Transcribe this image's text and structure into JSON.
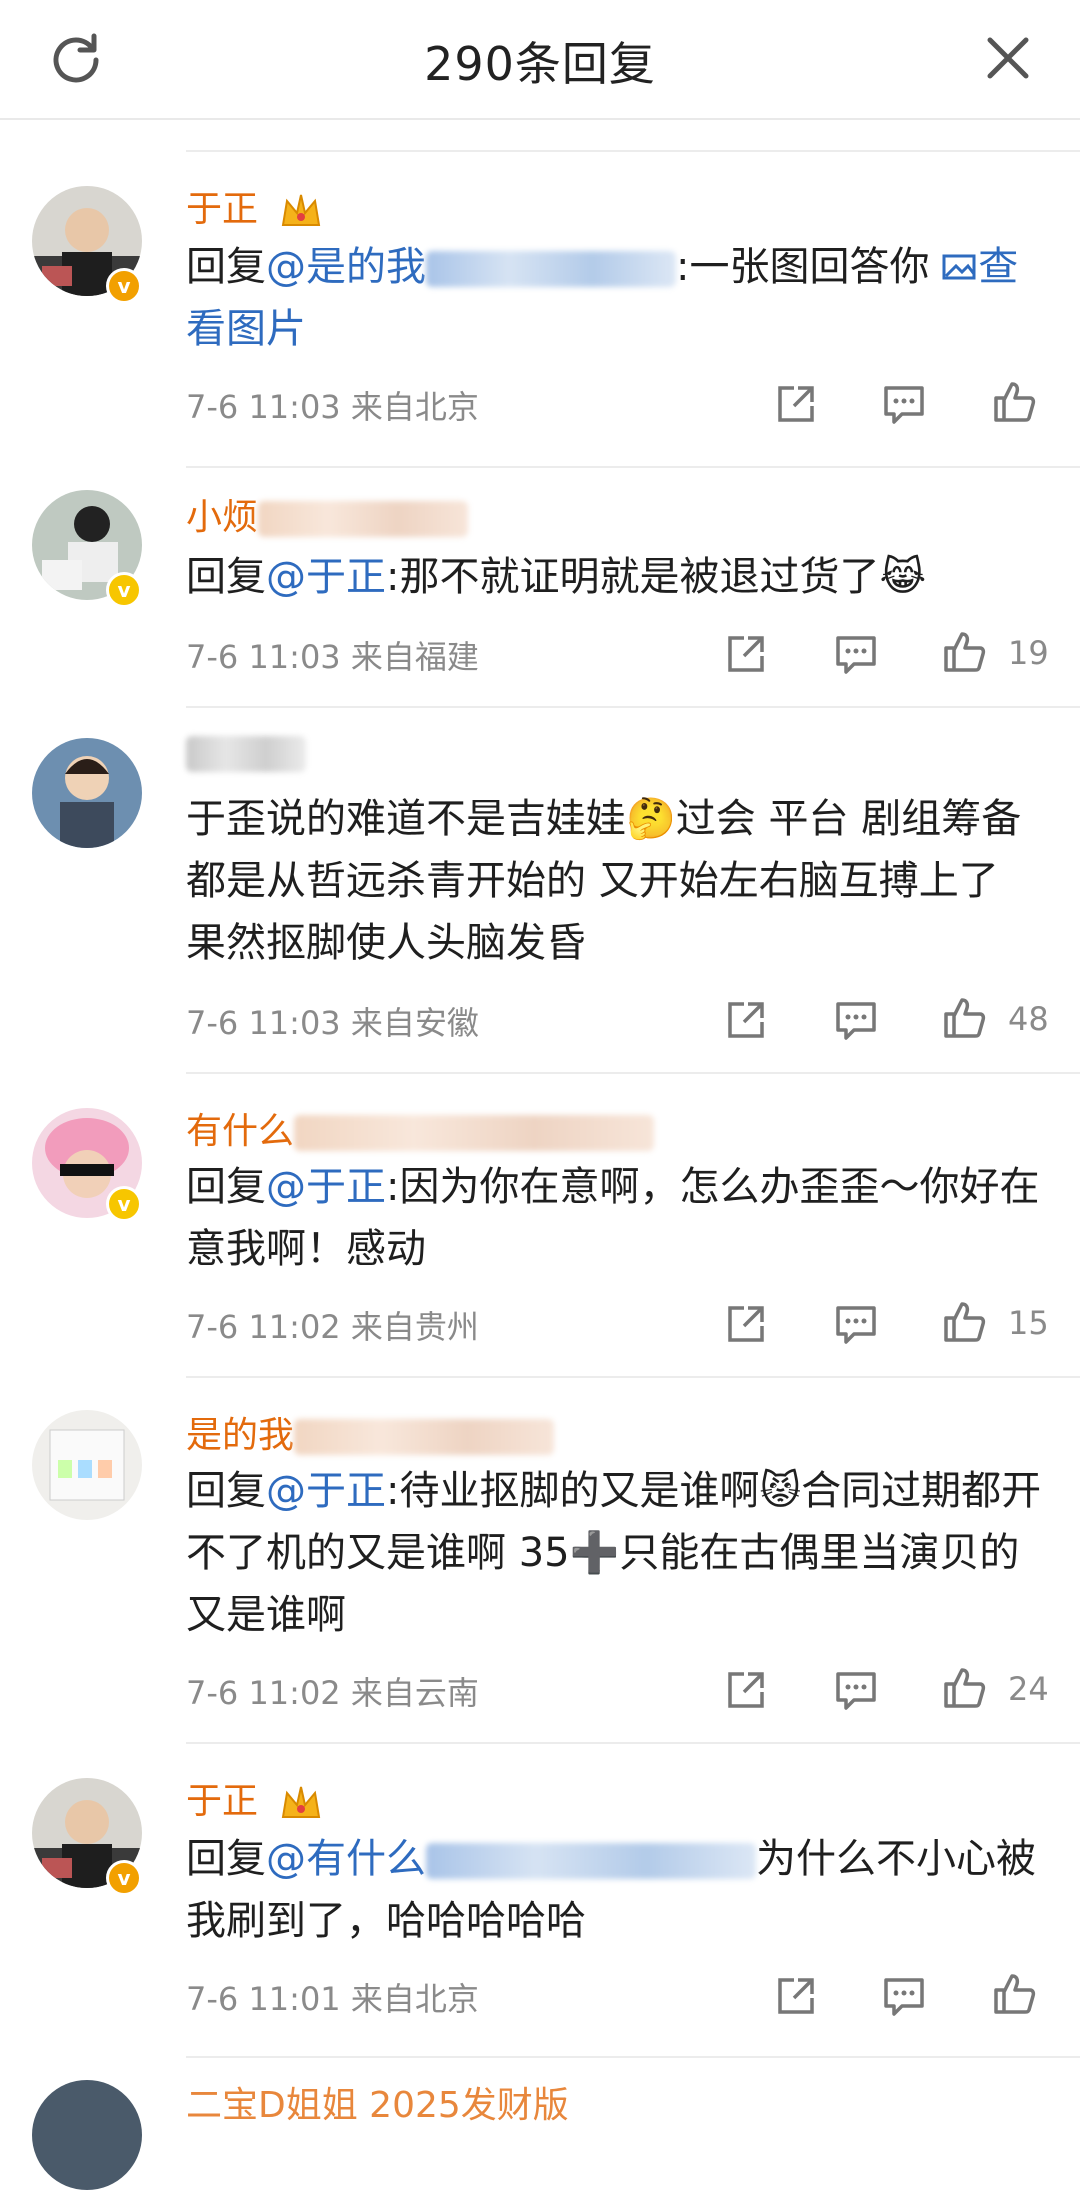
{
  "header": {
    "title": "290条回复"
  },
  "comments": [
    {
      "user": "于正",
      "text_prefix": "回复",
      "mention": "@是的我",
      "text_suffix": ":一张图回答你",
      "link": "查看图片",
      "time": "7-6 11:03",
      "location": "来自北京",
      "likes": ""
    },
    {
      "user": "小烦",
      "text_prefix": "回复",
      "mention": "@于正",
      "text_suffix": ":那不就证明就是被退过货了",
      "time": "7-6 11:03",
      "location": "来自福建",
      "likes": "19"
    },
    {
      "user": "",
      "text": "于歪说的难道不是吉娃娃🤔过会 平台 剧组筹备都是从哲远杀青开始的 又开始左右脑互搏上了 果然抠脚使人头脑发昏",
      "time": "7-6 11:03",
      "location": "来自安徽",
      "likes": "48"
    },
    {
      "user": "有什么",
      "text_prefix": "回复",
      "mention": "@于正",
      "text_suffix": ":因为你在意啊，怎么办歪歪～你好在意我啊！感动",
      "time": "7-6 11:02",
      "location": "来自贵州",
      "likes": "15"
    },
    {
      "user": "是的我",
      "text_prefix": "回复",
      "mention": "@于正",
      "text_suffix": ":待业抠脚的又是谁啊😾合同过期都开不了机的又是谁啊 35➕只能在古偶里当演贝的又是谁啊",
      "time": "7-6 11:02",
      "location": "来自云南",
      "likes": "24"
    },
    {
      "user": "于正",
      "text_prefix": "回复",
      "mention": "@有什么",
      "text_suffix": "为什么不小心被我刷到了，哈哈哈哈哈",
      "time": "7-6 11:01",
      "location": "来自北京",
      "likes": ""
    }
  ],
  "peek": {
    "user": "二宝D姐姐 2025发财版"
  },
  "colors": {
    "username": "#e36a0c",
    "mention": "#2e6bbf",
    "meta": "#8a8a8a",
    "badge": "#f2a000"
  }
}
